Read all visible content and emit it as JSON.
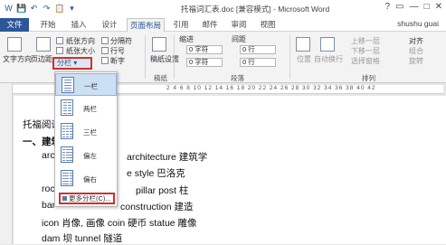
{
  "titlebar": {
    "title": "托福词汇表.doc [兼容模式] - Microsoft Word",
    "qat": [
      "W",
      "💾",
      "↶",
      "↷",
      "📋",
      "▾"
    ],
    "controls": [
      "?",
      "▭",
      "—",
      "□",
      "✕"
    ]
  },
  "tabs": [
    "文件",
    "开始",
    "插入",
    "设计",
    "页面布局",
    "引用",
    "邮件",
    "审阅",
    "视图"
  ],
  "user": "shushu guai",
  "ribbon": {
    "text_direction": "文字方向",
    "margins": "页边距",
    "orientation": "纸张方向",
    "size": "纸张大小",
    "columns": "分栏",
    "breaks": "分隔符",
    "line_numbers": "行号",
    "hyphenation": "断字",
    "page_setup_label": "稿纸设置",
    "draft_group_label": "稿纸",
    "indent_label": "缩进",
    "spacing_label": "间距",
    "indent_left": "0 字符",
    "indent_right": "0 字符",
    "spacing_before": "0 行",
    "spacing_after": "0 行",
    "paragraph_group_label": "段落",
    "position": "位置",
    "wrap_text": "自动换行",
    "bring_forward": "上移一层",
    "send_backward": "下移一层",
    "selection_pane": "选择窗格",
    "align": "对齐",
    "group": "组合",
    "rotate": "旋转",
    "arrange_group_label": "排列"
  },
  "ruler": {
    "numbers": "2  4  6  8  10  12  14  16  18  20  22  24  26  28  30  32  34  36  38  40  42"
  },
  "column_menu": {
    "items": [
      "一栏",
      "两栏",
      "三栏",
      "偏左",
      "偏右"
    ],
    "more": "更多分栏(C)..."
  },
  "document": {
    "lines": [
      "托福阅读",
      "一、建筑",
      "architecture  建筑学",
      "e style  巴洛克",
      "pillar post  柱",
      "construction  建造",
      "icon 肖像, 画像 coin 硬币    statue 雕像",
      "dam  坝    tunnel 隧道"
    ],
    "prefixes": [
      "arc",
      "",
      "roc",
      "bar"
    ]
  }
}
